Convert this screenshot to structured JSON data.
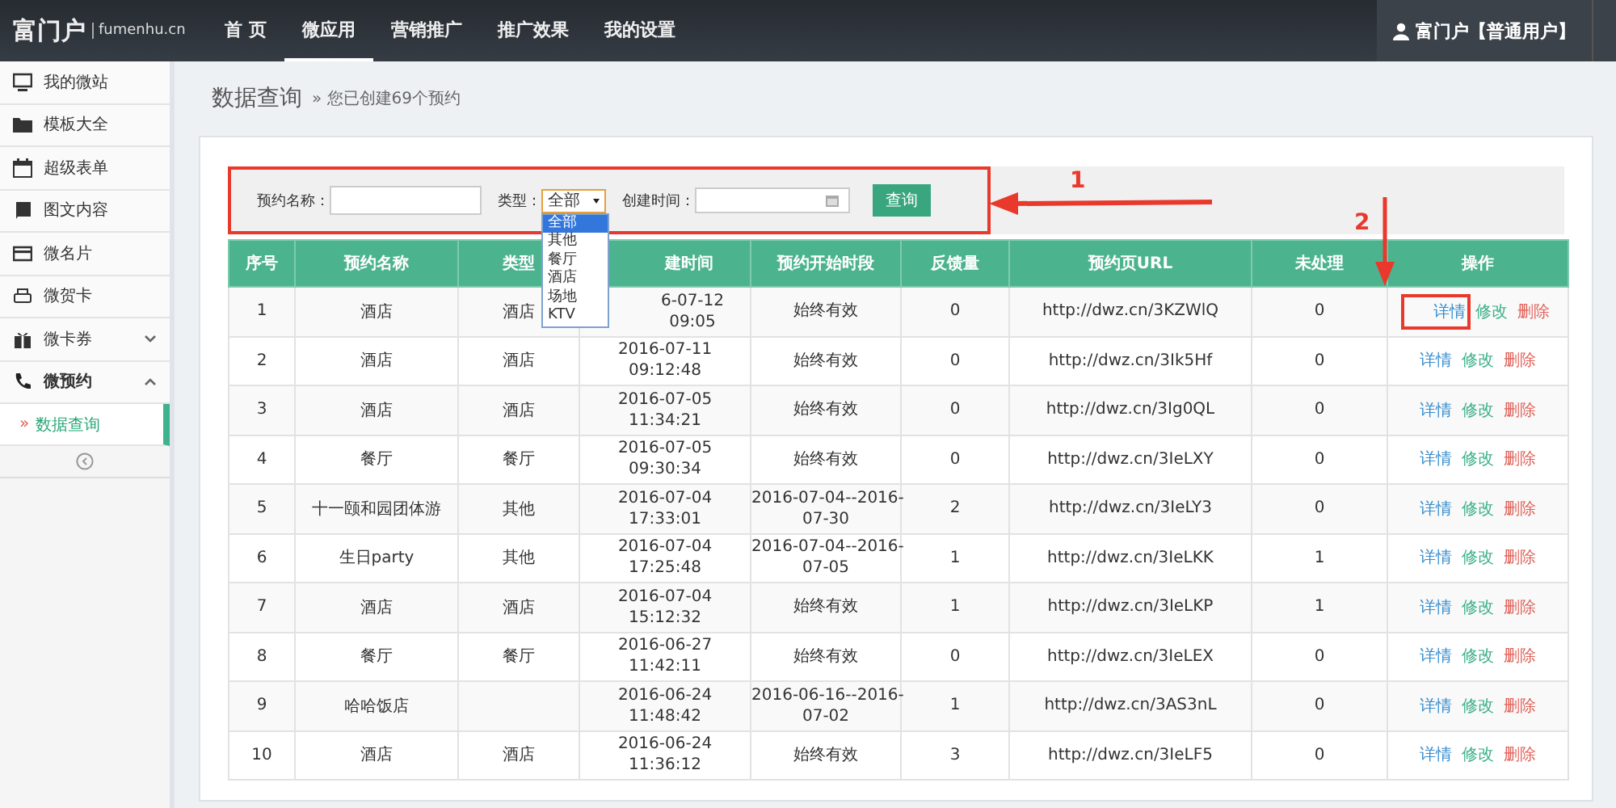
{
  "nav": {
    "logo": "富门户",
    "domain": "fumenhu.cn",
    "items": [
      {
        "label": "首 页",
        "selected": false
      },
      {
        "label": "微应用",
        "selected": true
      },
      {
        "label": "营销推广",
        "selected": false
      },
      {
        "label": "推广效果",
        "selected": false
      },
      {
        "label": "我的设置",
        "selected": false
      }
    ],
    "user": "富门户【普通用户】"
  },
  "sidebar": {
    "items": [
      {
        "label": "我的微站",
        "kind": "link"
      },
      {
        "label": "模板大全",
        "kind": "link"
      },
      {
        "label": "超级表单",
        "kind": "link"
      },
      {
        "label": "图文内容",
        "kind": "link"
      },
      {
        "label": "微名片",
        "kind": "link"
      },
      {
        "label": "微贺卡",
        "kind": "link"
      },
      {
        "label": "微卡券",
        "kind": "group",
        "expanded": false
      },
      {
        "label": "微预约",
        "kind": "group",
        "expanded": true,
        "children": [
          {
            "label": "数据查询",
            "marker": "»",
            "selected": true
          }
        ]
      }
    ]
  },
  "page": {
    "title": "数据查询",
    "subtitle": "» 您已创建69个预约"
  },
  "filter": {
    "name_label": "预约名称：",
    "type_label": "类型：",
    "type_value": "全部",
    "expanded": true,
    "options": [
      {
        "label": "全部",
        "selected": true
      },
      {
        "label": "其他",
        "selected": false
      },
      {
        "label": "餐厅",
        "selected": false
      },
      {
        "label": "酒店",
        "selected": false
      },
      {
        "label": "场地",
        "selected": false
      },
      {
        "label": "KTV",
        "selected": false
      }
    ],
    "created_label": "创建时间：",
    "button": "查询"
  },
  "table": {
    "columns": [
      "序号",
      "预约名称",
      "类型",
      "建时间",
      "预约开始时段",
      "反馈量",
      "预约页URL",
      "未处理",
      "操作"
    ],
    "rows": [
      {
        "index": "1",
        "name": "酒店",
        "type": "酒店",
        "date": "6-07-12",
        "time": "09:05",
        "period": "始终有效",
        "feedback": "0",
        "url": "http://dwz.cn/3KZWlQ",
        "pending": "0",
        "actions": [
          {
            "label": "详情",
            "kind": "view",
            "highlighted": true
          },
          {
            "label": "修改",
            "kind": "edit",
            "highlighted": false
          },
          {
            "label": "删除",
            "kind": "delete",
            "highlighted": false
          }
        ]
      },
      {
        "index": "2",
        "name": "酒店",
        "type": "酒店",
        "date": "2016-07-11",
        "time": "09:12:48",
        "period": "始终有效",
        "feedback": "0",
        "url": "http://dwz.cn/3Ik5Hf",
        "pending": "0",
        "actions": [
          {
            "label": "详情",
            "kind": "view",
            "highlighted": false
          },
          {
            "label": "修改",
            "kind": "edit",
            "highlighted": false
          },
          {
            "label": "删除",
            "kind": "delete",
            "highlighted": false
          }
        ]
      },
      {
        "index": "3",
        "name": "酒店",
        "type": "酒店",
        "date": "2016-07-05",
        "time": "11:34:21",
        "period": "始终有效",
        "feedback": "0",
        "url": "http://dwz.cn/3Ig0QL",
        "pending": "0",
        "actions": [
          {
            "label": "详情",
            "kind": "view",
            "highlighted": false
          },
          {
            "label": "修改",
            "kind": "edit",
            "highlighted": false
          },
          {
            "label": "删除",
            "kind": "delete",
            "highlighted": false
          }
        ]
      },
      {
        "index": "4",
        "name": "餐厅",
        "type": "餐厅",
        "date": "2016-07-05",
        "time": "09:30:34",
        "period": "始终有效",
        "feedback": "0",
        "url": "http://dwz.cn/3IeLXY",
        "pending": "0",
        "actions": [
          {
            "label": "详情",
            "kind": "view",
            "highlighted": false
          },
          {
            "label": "修改",
            "kind": "edit",
            "highlighted": false
          },
          {
            "label": "删除",
            "kind": "delete",
            "highlighted": false
          }
        ]
      },
      {
        "index": "5",
        "name": "十一颐和园团体游",
        "type": "其他",
        "date": "2016-07-04",
        "time": "17:33:01",
        "period": "2016-07-04--2016-07-30",
        "feedback": "2",
        "url": "http://dwz.cn/3IeLY3",
        "pending": "0",
        "actions": [
          {
            "label": "详情",
            "kind": "view",
            "highlighted": false
          },
          {
            "label": "修改",
            "kind": "edit",
            "highlighted": false
          },
          {
            "label": "删除",
            "kind": "delete",
            "highlighted": false
          }
        ]
      },
      {
        "index": "6",
        "name": "生日party",
        "type": "其他",
        "date": "2016-07-04",
        "time": "17:25:48",
        "period": "2016-07-04--2016-07-05",
        "feedback": "1",
        "url": "http://dwz.cn/3IeLKK",
        "pending": "1",
        "actions": [
          {
            "label": "详情",
            "kind": "view",
            "highlighted": false
          },
          {
            "label": "修改",
            "kind": "edit",
            "highlighted": false
          },
          {
            "label": "删除",
            "kind": "delete",
            "highlighted": false
          }
        ]
      },
      {
        "index": "7",
        "name": "酒店",
        "type": "酒店",
        "date": "2016-07-04",
        "time": "15:12:32",
        "period": "始终有效",
        "feedback": "1",
        "url": "http://dwz.cn/3IeLKP",
        "pending": "1",
        "actions": [
          {
            "label": "详情",
            "kind": "view",
            "highlighted": false
          },
          {
            "label": "修改",
            "kind": "edit",
            "highlighted": false
          },
          {
            "label": "删除",
            "kind": "delete",
            "highlighted": false
          }
        ]
      },
      {
        "index": "8",
        "name": "餐厅",
        "type": "餐厅",
        "date": "2016-06-27",
        "time": "11:42:11",
        "period": "始终有效",
        "feedback": "0",
        "url": "http://dwz.cn/3IeLEX",
        "pending": "0",
        "actions": [
          {
            "label": "详情",
            "kind": "view",
            "highlighted": false
          },
          {
            "label": "修改",
            "kind": "edit",
            "highlighted": false
          },
          {
            "label": "删除",
            "kind": "delete",
            "highlighted": false
          }
        ]
      },
      {
        "index": "9",
        "name": "哈哈饭店",
        "date": "2016-06-24",
        "time": "11:48:42",
        "period": "2016-06-16--2016-07-02",
        "feedback": "1",
        "url": "http://dwz.cn/3AS3nL",
        "pending": "0",
        "actions": [
          {
            "label": "详情",
            "kind": "view",
            "highlighted": false
          },
          {
            "label": "修改",
            "kind": "edit",
            "highlighted": false
          },
          {
            "label": "删除",
            "kind": "delete",
            "highlighted": false
          }
        ]
      },
      {
        "index": "10",
        "name": "酒店",
        "type": "酒店",
        "date": "2016-06-24",
        "time": "11:36:12",
        "period": "始终有效",
        "feedback": "3",
        "url": "http://dwz.cn/3IeLF5",
        "pending": "0",
        "actions": [
          {
            "label": "详情",
            "kind": "view",
            "highlighted": false
          },
          {
            "label": "修改",
            "kind": "edit",
            "highlighted": false
          },
          {
            "label": "删除",
            "kind": "delete",
            "highlighted": false
          }
        ]
      }
    ]
  },
  "annotations": [
    {
      "label": "1"
    },
    {
      "label": "2"
    }
  ]
}
